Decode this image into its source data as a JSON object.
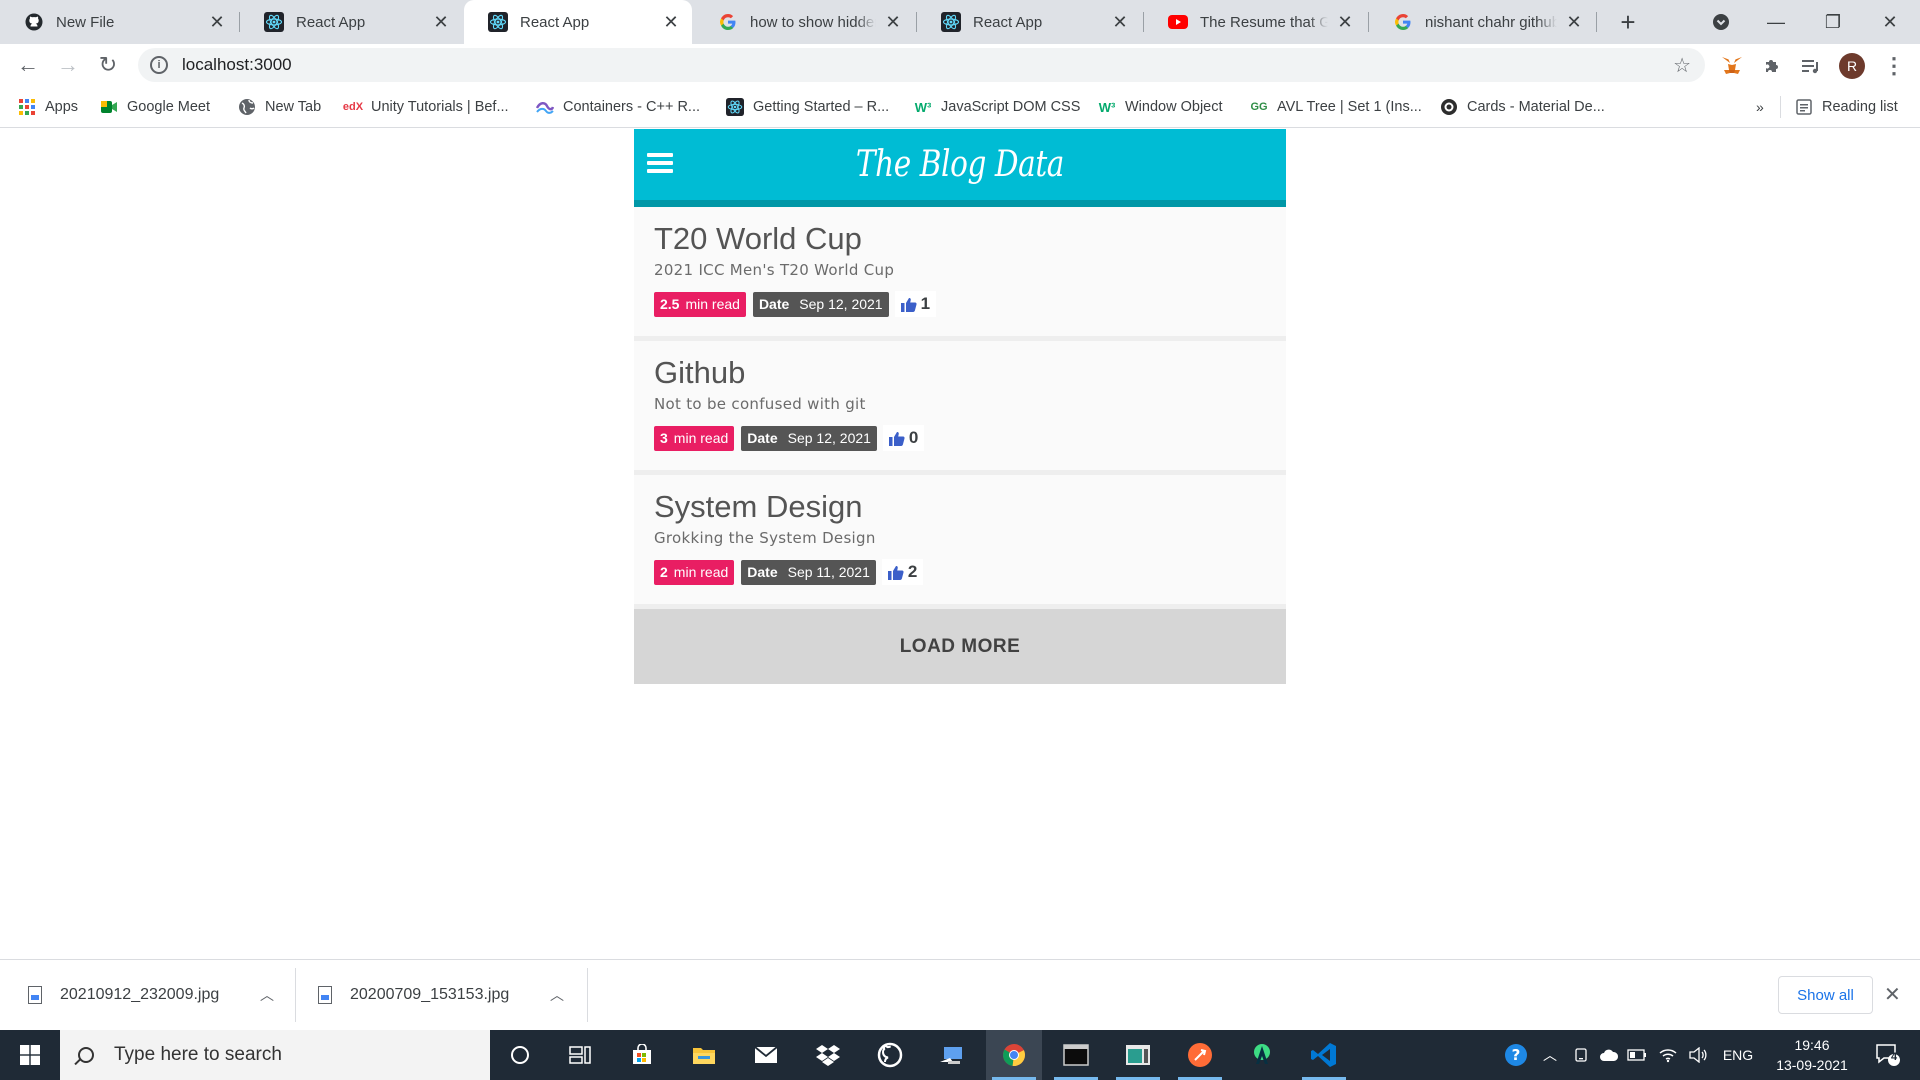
{
  "browser": {
    "tabs": [
      {
        "title": "New File",
        "icon": "github-icon"
      },
      {
        "title": "React App",
        "icon": "react-icon"
      },
      {
        "title": "React App",
        "icon": "react-icon",
        "active": true
      },
      {
        "title": "how to show hidden files",
        "icon": "google-icon"
      },
      {
        "title": "React App",
        "icon": "react-icon"
      },
      {
        "title": "The Resume that Got",
        "icon": "youtube-icon"
      },
      {
        "title": "nishant chahr github",
        "icon": "google-icon"
      }
    ],
    "url": "localhost:3000",
    "profile_initial": "R",
    "bookmarks": [
      {
        "label": "Apps"
      },
      {
        "label": "Google Meet"
      },
      {
        "label": "New Tab"
      },
      {
        "label": "Unity Tutorials | Bef..."
      },
      {
        "label": "Containers - C++ R..."
      },
      {
        "label": "Getting Started – R..."
      },
      {
        "label": "JavaScript DOM CSS"
      },
      {
        "label": "Window Object"
      },
      {
        "label": "AVL Tree | Set 1 (Ins..."
      },
      {
        "label": "Cards - Material De..."
      }
    ],
    "more_bookmarks": "»",
    "reading_list": "Reading list"
  },
  "blog": {
    "title": "The Blog Data",
    "read_unit": "min read",
    "date_label": "Date",
    "posts": [
      {
        "title": "T20 World Cup",
        "subtitle": "2021 ICC Men's T20 World Cup",
        "read_time": "2.5",
        "date": "Sep 12, 2021",
        "likes": "1"
      },
      {
        "title": "Github",
        "subtitle": "Not to be confused with git",
        "read_time": "3",
        "date": "Sep 12, 2021",
        "likes": "0"
      },
      {
        "title": "System Design",
        "subtitle": "Grokking the System Design",
        "read_time": "2",
        "date": "Sep 11, 2021",
        "likes": "2"
      }
    ],
    "load_more": "LOAD MORE",
    "colors": {
      "header": "#00bcd4",
      "read_badge": "#e91e63",
      "date_badge": "#555555",
      "like_icon": "#3b5fc9"
    }
  },
  "downloads": {
    "files": [
      {
        "name": "20210912_232009.jpg"
      },
      {
        "name": "20200709_153153.jpg"
      }
    ],
    "show_all": "Show all"
  },
  "taskbar": {
    "search_placeholder": "Type here to search",
    "language": "ENG",
    "time": "19:46",
    "date": "13-09-2021",
    "notification_count": "4"
  }
}
